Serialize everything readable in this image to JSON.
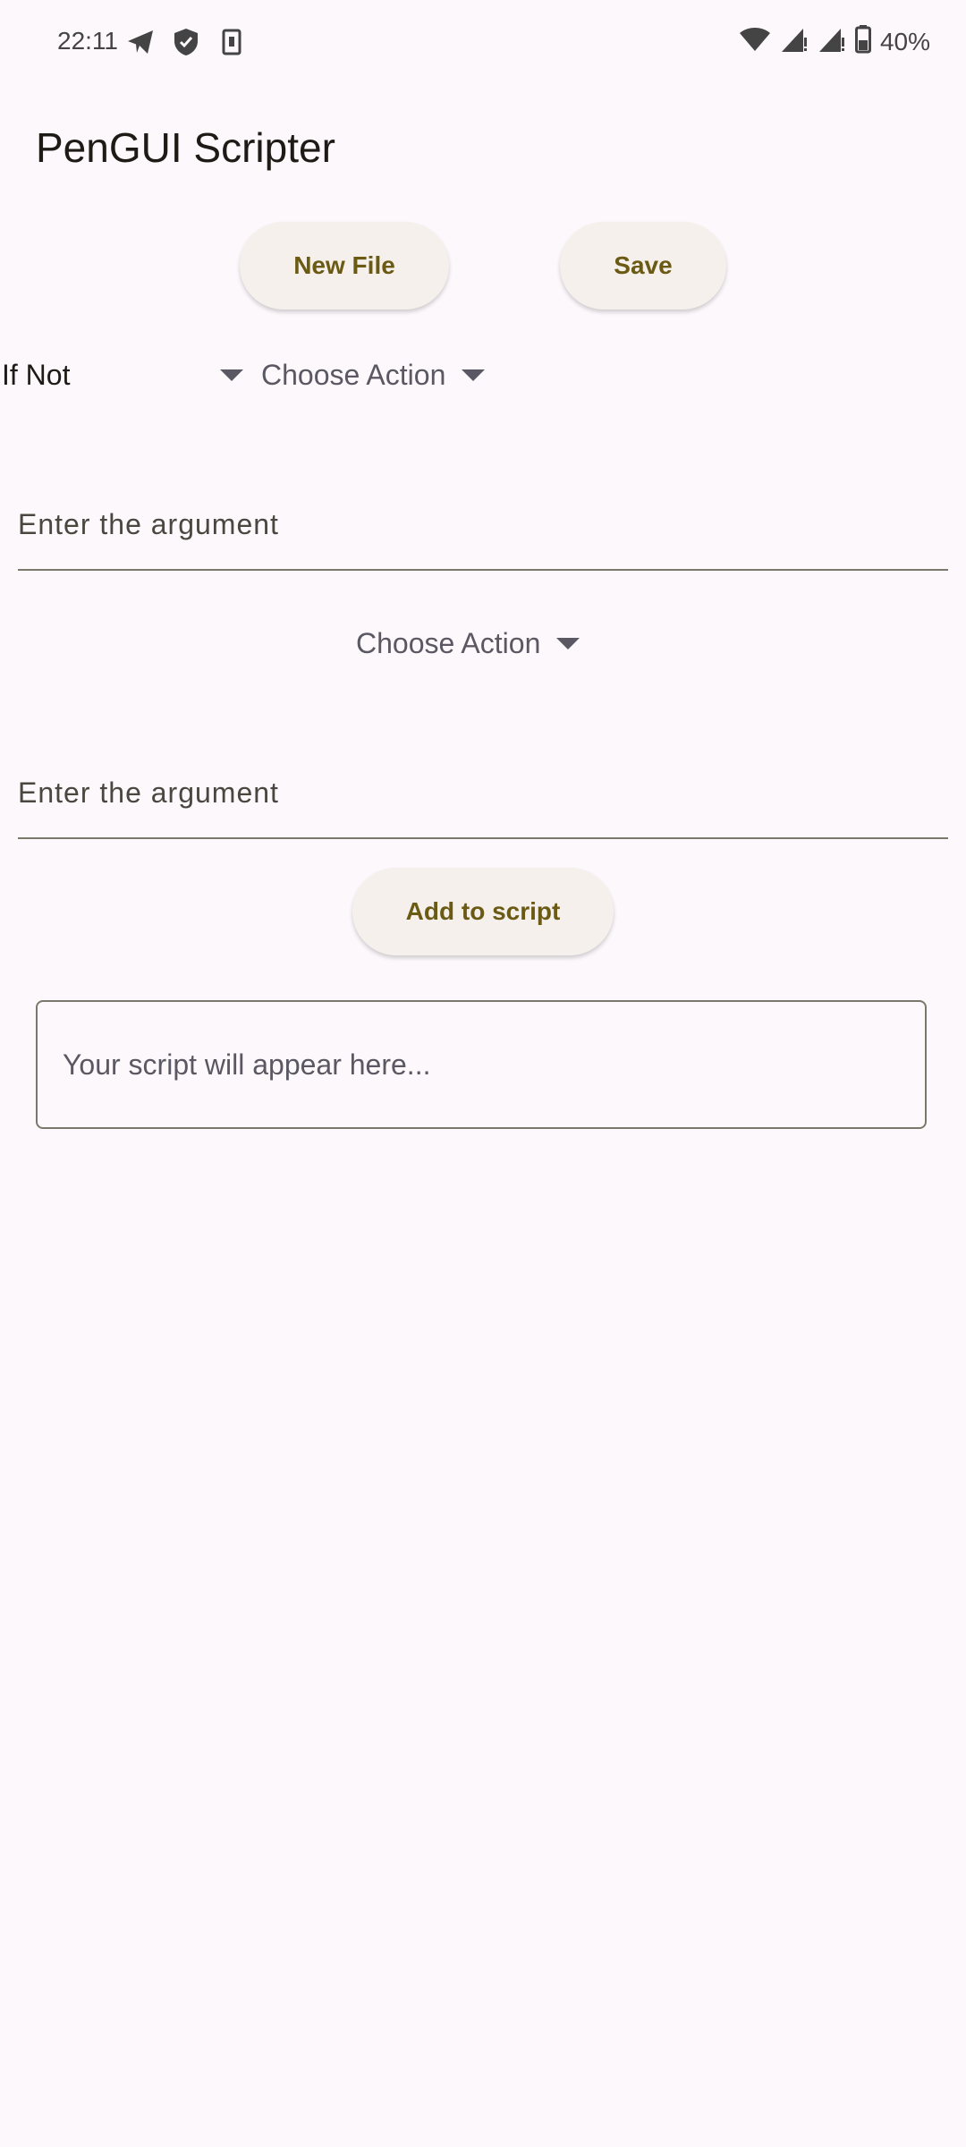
{
  "status_bar": {
    "time": "22:11",
    "left_icons": [
      "telegram-icon",
      "shield-check-icon",
      "screenshot-icon"
    ],
    "right_icons": [
      "wifi-icon",
      "signal-icon",
      "signal-icon",
      "battery-icon"
    ],
    "battery": "40%"
  },
  "app_bar": {
    "title": "PenGUI Scripter"
  },
  "toolbar": {
    "new_file_label": "New File",
    "save_label": "Save"
  },
  "condition_row": {
    "condition_value": "If Not",
    "action_placeholder": "Choose Action"
  },
  "first_argument": {
    "placeholder": "Enter the argument"
  },
  "second_action": {
    "action_placeholder": "Choose Action"
  },
  "second_argument": {
    "placeholder": "Enter the argument"
  },
  "add_button": {
    "label": "Add to script"
  },
  "script_output": {
    "placeholder": "Your script will appear here..."
  },
  "colors": {
    "background": "#fdf8fc",
    "button_background": "#f5f0ec",
    "button_text": "#6b5a13",
    "outline": "#7b776a"
  }
}
